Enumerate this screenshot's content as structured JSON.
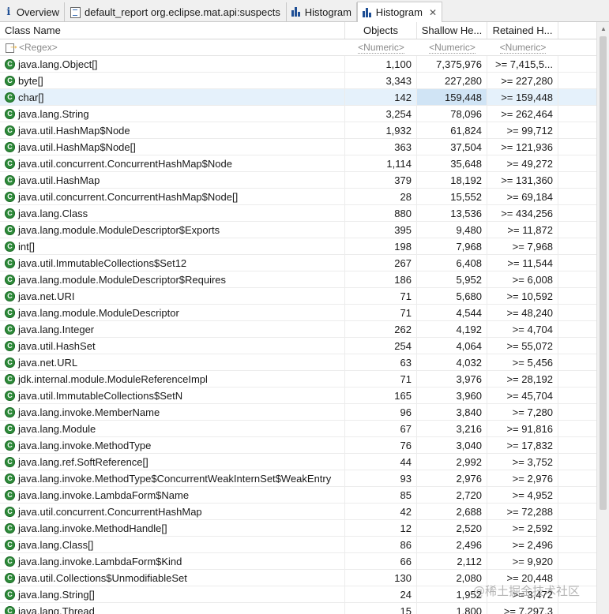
{
  "tabs": [
    {
      "label": "Overview",
      "icon": "info-icon"
    },
    {
      "label": "default_report  org.eclipse.mat.api:suspects",
      "icon": "report-icon"
    },
    {
      "label": "Histogram",
      "icon": "histogram-icon"
    },
    {
      "label": "Histogram",
      "icon": "histogram-icon",
      "active": true
    }
  ],
  "columns": {
    "name": "Class Name",
    "objects": "Objects",
    "shallow": "Shallow He...",
    "retained": "Retained H..."
  },
  "filters": {
    "name": "<Regex>",
    "objects": "<Numeric>",
    "shallow": "<Numeric>",
    "retained": "<Numeric>"
  },
  "rows": [
    {
      "name": "java.lang.Object[]",
      "objects": "1,100",
      "shallow": "7,375,976",
      "retained": ">= 7,415,5..."
    },
    {
      "name": "byte[]",
      "objects": "3,343",
      "shallow": "227,280",
      "retained": ">= 227,280"
    },
    {
      "name": "char[]",
      "objects": "142",
      "shallow": "159,448",
      "retained": ">= 159,448",
      "selected": true
    },
    {
      "name": "java.lang.String",
      "objects": "3,254",
      "shallow": "78,096",
      "retained": ">= 262,464"
    },
    {
      "name": "java.util.HashMap$Node",
      "objects": "1,932",
      "shallow": "61,824",
      "retained": ">= 99,712"
    },
    {
      "name": "java.util.HashMap$Node[]",
      "objects": "363",
      "shallow": "37,504",
      "retained": ">= 121,936"
    },
    {
      "name": "java.util.concurrent.ConcurrentHashMap$Node",
      "objects": "1,114",
      "shallow": "35,648",
      "retained": ">= 49,272"
    },
    {
      "name": "java.util.HashMap",
      "objects": "379",
      "shallow": "18,192",
      "retained": ">= 131,360"
    },
    {
      "name": "java.util.concurrent.ConcurrentHashMap$Node[]",
      "objects": "28",
      "shallow": "15,552",
      "retained": ">= 69,184"
    },
    {
      "name": "java.lang.Class",
      "objects": "880",
      "shallow": "13,536",
      "retained": ">= 434,256"
    },
    {
      "name": "java.lang.module.ModuleDescriptor$Exports",
      "objects": "395",
      "shallow": "9,480",
      "retained": ">= 11,872"
    },
    {
      "name": "int[]",
      "objects": "198",
      "shallow": "7,968",
      "retained": ">= 7,968"
    },
    {
      "name": "java.util.ImmutableCollections$Set12",
      "objects": "267",
      "shallow": "6,408",
      "retained": ">= 11,544"
    },
    {
      "name": "java.lang.module.ModuleDescriptor$Requires",
      "objects": "186",
      "shallow": "5,952",
      "retained": ">= 6,008"
    },
    {
      "name": "java.net.URI",
      "objects": "71",
      "shallow": "5,680",
      "retained": ">= 10,592"
    },
    {
      "name": "java.lang.module.ModuleDescriptor",
      "objects": "71",
      "shallow": "4,544",
      "retained": ">= 48,240"
    },
    {
      "name": "java.lang.Integer",
      "objects": "262",
      "shallow": "4,192",
      "retained": ">= 4,704"
    },
    {
      "name": "java.util.HashSet",
      "objects": "254",
      "shallow": "4,064",
      "retained": ">= 55,072"
    },
    {
      "name": "java.net.URL",
      "objects": "63",
      "shallow": "4,032",
      "retained": ">= 5,456"
    },
    {
      "name": "jdk.internal.module.ModuleReferenceImpl",
      "objects": "71",
      "shallow": "3,976",
      "retained": ">= 28,192"
    },
    {
      "name": "java.util.ImmutableCollections$SetN",
      "objects": "165",
      "shallow": "3,960",
      "retained": ">= 45,704"
    },
    {
      "name": "java.lang.invoke.MemberName",
      "objects": "96",
      "shallow": "3,840",
      "retained": ">= 7,280"
    },
    {
      "name": "java.lang.Module",
      "objects": "67",
      "shallow": "3,216",
      "retained": ">= 91,816"
    },
    {
      "name": "java.lang.invoke.MethodType",
      "objects": "76",
      "shallow": "3,040",
      "retained": ">= 17,832"
    },
    {
      "name": "java.lang.ref.SoftReference[]",
      "objects": "44",
      "shallow": "2,992",
      "retained": ">= 3,752"
    },
    {
      "name": "java.lang.invoke.MethodType$ConcurrentWeakInternSet$WeakEntry",
      "objects": "93",
      "shallow": "2,976",
      "retained": ">= 2,976"
    },
    {
      "name": "java.lang.invoke.LambdaForm$Name",
      "objects": "85",
      "shallow": "2,720",
      "retained": ">= 4,952"
    },
    {
      "name": "java.util.concurrent.ConcurrentHashMap",
      "objects": "42",
      "shallow": "2,688",
      "retained": ">= 72,288"
    },
    {
      "name": "java.lang.invoke.MethodHandle[]",
      "objects": "12",
      "shallow": "2,520",
      "retained": ">= 2,592"
    },
    {
      "name": "java.lang.Class[]",
      "objects": "86",
      "shallow": "2,496",
      "retained": ">= 2,496"
    },
    {
      "name": "java.lang.invoke.LambdaForm$Kind",
      "objects": "66",
      "shallow": "2,112",
      "retained": ">= 9,920"
    },
    {
      "name": "java.util.Collections$UnmodifiableSet",
      "objects": "130",
      "shallow": "2,080",
      "retained": ">= 20,448"
    },
    {
      "name": "java.lang.String[]",
      "objects": "24",
      "shallow": "1,952",
      "retained": ">= 3,472"
    },
    {
      "name": "java.lang.Thread",
      "objects": "15",
      "shallow": "1,800",
      "retained": ">= 7,297.3"
    }
  ],
  "watermark": "@稀土掘金技术社区"
}
